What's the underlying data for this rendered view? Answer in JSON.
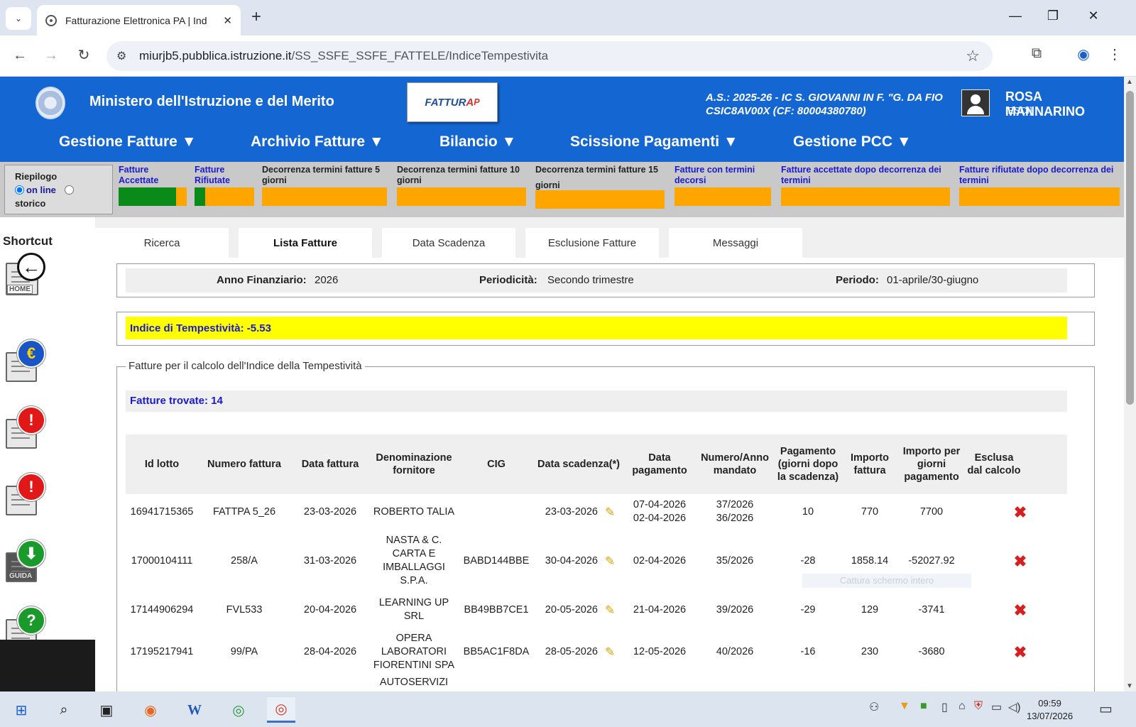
{
  "browser": {
    "tab_title": "Fatturazione Elettronica PA | Ind",
    "url_host": "miurjb5.pubblica.istruzione.it",
    "url_path": "/SS_SSFE_SSFE_FATTELE/IndiceTempestivita"
  },
  "header": {
    "ministry": "Ministero dell'Istruzione e del Merito",
    "logo_text_main": "FATTUR",
    "logo_text_accent": "A",
    "logo_text_sub": "P",
    "school_line1": "A.S.: 2025-26  - IC S. GIOVANNI IN F. \"G. DA FIO",
    "school_line2": "CSIC8AV00X  (CF: 80004380780)",
    "user_name": "ROSA MANNARINO",
    "esci": "[ESCI]"
  },
  "menu": [
    "Gestione Fatture ▼",
    "Archivio Fatture ▼",
    "Bilancio ▼",
    "Scissione Pagamenti ▼",
    "Gestione PCC ▼"
  ],
  "summary": {
    "riepilogo": "Riepilogo",
    "online": "on line",
    "storico": "storico",
    "columns": [
      {
        "label": "Fatture Accettate",
        "green_fraction": 0.84
      },
      {
        "label": "Fatture Rifiutate",
        "green_fraction": 0.18
      },
      {
        "label": "Decorrenza termini fatture 5 giorni",
        "green_fraction": 0
      },
      {
        "label": "Decorrenza termini fatture 10 giorni",
        "green_fraction": 0
      },
      {
        "label": "Decorrenza termini fatture 15 giorni",
        "green_fraction": 0
      },
      {
        "label": "Fatture con termini decorsi",
        "green_fraction": 0
      },
      {
        "label": "Fatture accettate dopo decorrenza dei termini",
        "green_fraction": 0
      },
      {
        "label": "Fatture rifiutate dopo decorrenza dei termini",
        "green_fraction": 0
      }
    ]
  },
  "shortcut": {
    "title": "Shortcut",
    "home_label": "HOME",
    "guida_label": "GUIDA"
  },
  "tabs": [
    "Ricerca",
    "Lista Fatture",
    "Data Scadenza",
    "Esclusione Fatture",
    "Messaggi"
  ],
  "filters": {
    "anno_label": "Anno Finanziario:",
    "anno_value": "2026",
    "periodicita_label": "Periodicità:",
    "periodicita_value": "Secondo trimestre",
    "periodo_label": "Periodo:",
    "periodo_value": "01-aprile/30-giugno"
  },
  "indice": "Indice di Tempestività: -5.53",
  "fieldset_legend": "Fatture per il calcolo dell'Indice della Tempestività",
  "found": "Fatture trovate: 14",
  "table": {
    "headers": [
      "Id lotto",
      "Numero fattura",
      "Data fattura",
      "Denominazione fornitore",
      "CIG",
      "Data scadenza(*)",
      "Data pagamento",
      "Numero/Anno mandato",
      "Pagamento (giorni dopo la scadenza)",
      "Importo fattura",
      "Importo per giorni pagamento",
      "Esclusa dal calcolo"
    ],
    "rows": [
      {
        "id": "16941715365",
        "numero": "FATTPA 5_26",
        "data": "23-03-2026",
        "fornitore": "ROBERTO TALIA",
        "cig": "",
        "scadenza": "23-03-2026",
        "pagamento": "07-04-2026\n02-04-2026",
        "mandato": "37/2026\n36/2026",
        "giorni": "10",
        "importo": "770",
        "importo_giorni": "7700"
      },
      {
        "id": "17000104111",
        "numero": "258/A",
        "data": "31-03-2026",
        "fornitore": "NASTA & C. CARTA E IMBALLAGGI S.P.A.",
        "cig": "BABD144BBE",
        "scadenza": "30-04-2026",
        "pagamento": "02-04-2026",
        "mandato": "35/2026",
        "giorni": "-28",
        "importo": "1858.14",
        "importo_giorni": "-52027.92"
      },
      {
        "id": "17144906294",
        "numero": "FVL533",
        "data": "20-04-2026",
        "fornitore": "LEARNING UP SRL",
        "cig": "BB49BB7CE1",
        "scadenza": "20-05-2026",
        "pagamento": "21-04-2026",
        "mandato": "39/2026",
        "giorni": "-29",
        "importo": "129",
        "importo_giorni": "-3741"
      },
      {
        "id": "17195217941",
        "numero": "99/PA",
        "data": "28-04-2026",
        "fornitore": "OPERA LABORATORI FIORENTINI SPA",
        "cig": "BB5AC1F8DA",
        "scadenza": "28-05-2026",
        "pagamento": "12-05-2026",
        "mandato": "40/2026",
        "giorni": "-16",
        "importo": "230",
        "importo_giorni": "-3680"
      },
      {
        "id": "",
        "numero": "",
        "data": "",
        "fornitore": "AUTOSERVIZI",
        "cig": "",
        "scadenza": "",
        "pagamento": "",
        "mandato": "",
        "giorni": "",
        "importo": "",
        "importo_giorni": ""
      }
    ]
  },
  "overlay_hint": "Cattura schermo intero",
  "taskbar": {
    "time": "09:59",
    "date": "13/07/2026"
  }
}
